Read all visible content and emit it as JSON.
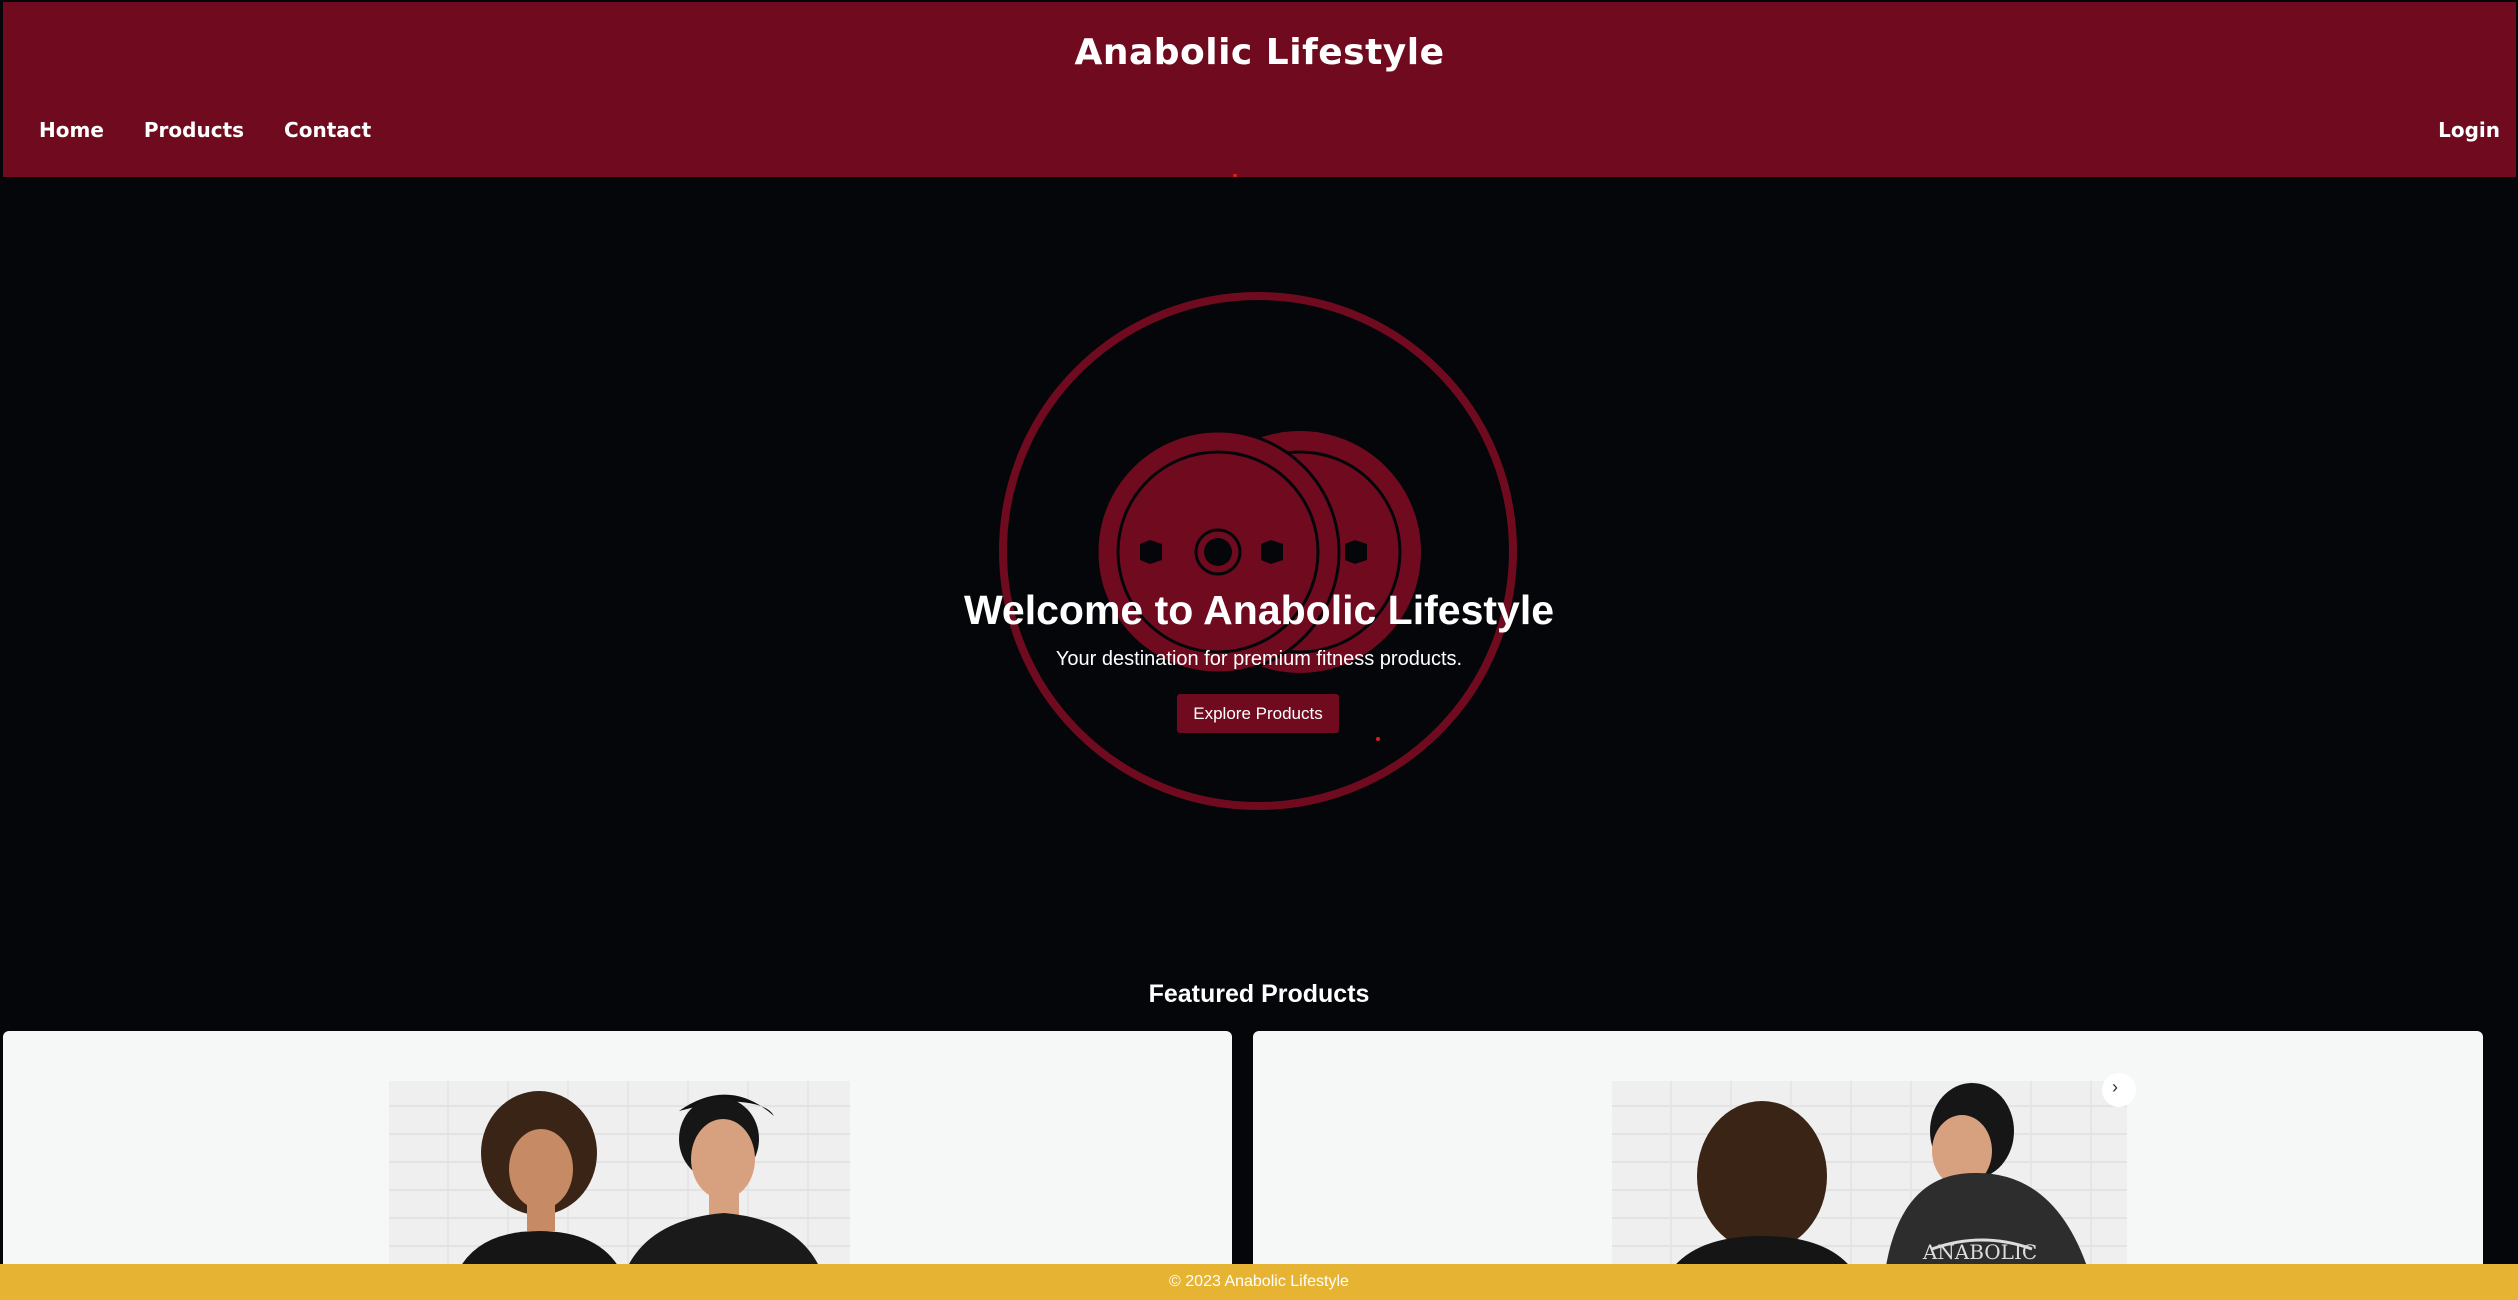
{
  "header": {
    "title": "Anabolic Lifestyle",
    "nav": [
      "Home",
      "Products",
      "Contact"
    ],
    "login_label": "Login"
  },
  "hero": {
    "title": "Welcome to Anabolic Lifestyle",
    "subtitle": "Your destination for premium fitness products.",
    "button_label": "Explore Products",
    "logo_icon": "weight-plates-icon"
  },
  "featured": {
    "title": "Featured Products",
    "products": [
      {
        "image": "couple-front-black-tshirts-photo"
      },
      {
        "image": "couple-back-black-tshirts-photo",
        "print_text": "ANABOLIC"
      }
    ]
  },
  "footer": {
    "text": "© 2023 Anabolic Lifestyle"
  },
  "colors": {
    "header_bg": "#700b1f",
    "page_bg": "#04060a",
    "accent": "#700b1f",
    "footer_bg": "#e6b432"
  }
}
